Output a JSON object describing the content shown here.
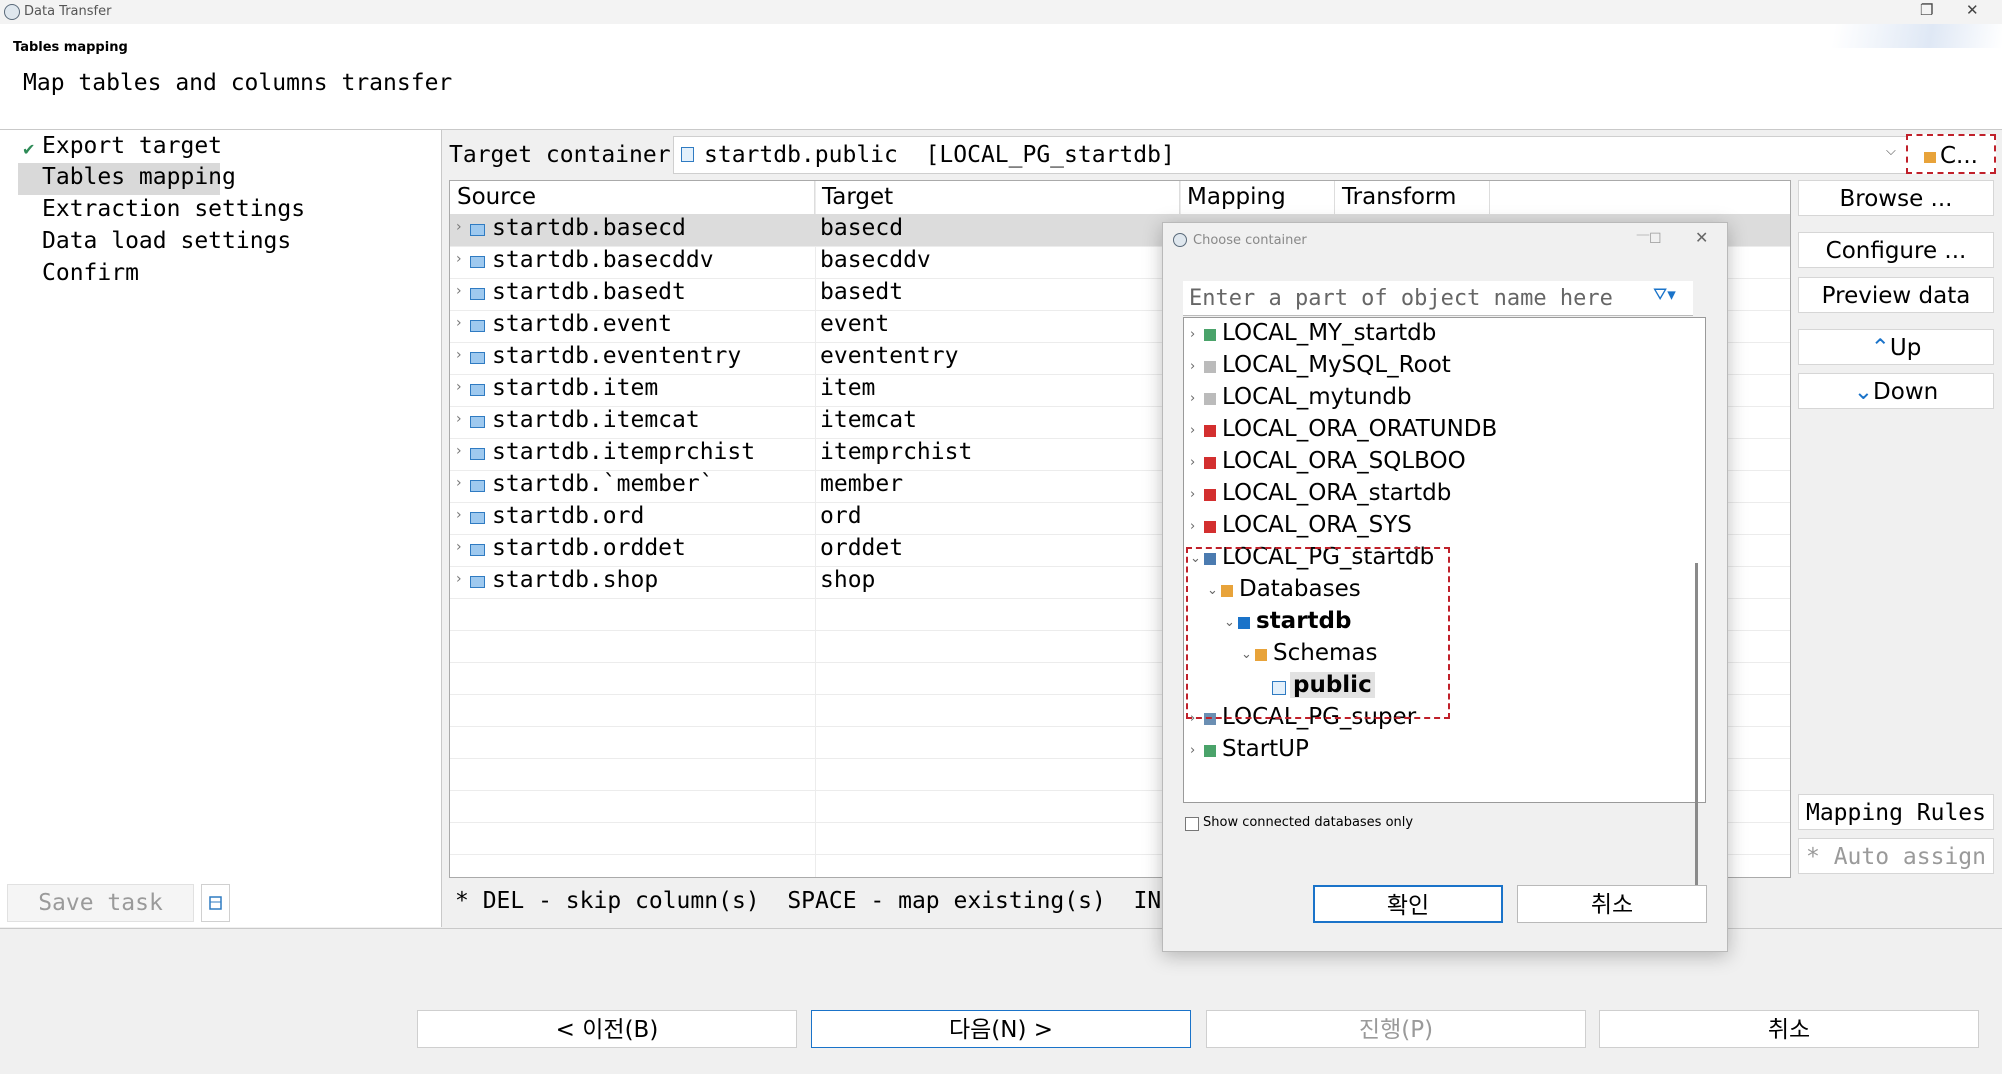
{
  "window": {
    "title": "Data Transfer"
  },
  "header": {
    "page_title": "Tables mapping",
    "description": "Map tables and columns transfer"
  },
  "nav": {
    "items": [
      "Export target",
      "Tables mapping",
      "Extraction settings",
      "Data load settings",
      "Confirm"
    ],
    "selected": "Tables mapping",
    "save_task": "Save task"
  },
  "target": {
    "label": "Target container:",
    "value": "startdb.public  [LOCAL_PG_startdb]",
    "choose_button": "C..."
  },
  "grid": {
    "columns": [
      "Source",
      "Target",
      "Mapping",
      "Transform"
    ],
    "rows": [
      {
        "source": "startdb.basecd",
        "target": "basecd"
      },
      {
        "source": "startdb.basecddv",
        "target": "basecddv"
      },
      {
        "source": "startdb.basedt",
        "target": "basedt"
      },
      {
        "source": "startdb.event",
        "target": "event"
      },
      {
        "source": "startdb.evententry",
        "target": "evententry"
      },
      {
        "source": "startdb.item",
        "target": "item"
      },
      {
        "source": "startdb.itemcat",
        "target": "itemcat"
      },
      {
        "source": "startdb.itemprchist",
        "target": "itemprchist"
      },
      {
        "source": "startdb.`member`",
        "target": "member"
      },
      {
        "source": "startdb.ord",
        "target": "ord"
      },
      {
        "source": "startdb.orddet",
        "target": "orddet"
      },
      {
        "source": "startdb.shop",
        "target": "shop"
      }
    ],
    "hint": "* DEL - skip column(s)  SPACE - map existing(s)  INSERT -"
  },
  "side_buttons": {
    "browse": "Browse ...",
    "configure": "Configure ...",
    "preview": "Preview data",
    "up": "Up",
    "down": "Down",
    "mapping_rules": "Mapping Rules",
    "auto_assign": "Auto assign"
  },
  "dialog": {
    "title": "Choose container",
    "search_placeholder": "Enter a part of object name here",
    "tree": [
      {
        "label": "LOCAL_MY_startdb",
        "icon": "mysql-connected-icon"
      },
      {
        "label": "LOCAL_MySQL_Root",
        "icon": "mysql-icon"
      },
      {
        "label": "LOCAL_mytundb",
        "icon": "mysql-icon"
      },
      {
        "label": "LOCAL_ORA_ORATUNDB",
        "icon": "oracle-icon"
      },
      {
        "label": "LOCAL_ORA_SQLBOO",
        "icon": "oracle-icon"
      },
      {
        "label": "LOCAL_ORA_startdb",
        "icon": "oracle-icon"
      },
      {
        "label": "LOCAL_ORA_SYS",
        "icon": "oracle-icon"
      },
      {
        "label": "LOCAL_PG_startdb",
        "icon": "postgres-connected-icon"
      },
      {
        "label": "Databases",
        "icon": "folder-icon"
      },
      {
        "label": "startdb",
        "icon": "database-icon"
      },
      {
        "label": "Schemas",
        "icon": "folder-icon"
      },
      {
        "label": "public",
        "icon": "schema-icon"
      },
      {
        "label": "LOCAL_PG_super",
        "icon": "postgres-icon"
      },
      {
        "label": "StartUP",
        "icon": "mysql-connected-icon"
      }
    ],
    "show_connected_label": "Show connected databases only",
    "ok": "확인",
    "cancel": "취소"
  },
  "footer": {
    "prev": "< 이전(B)",
    "next": "다음(N) >",
    "proceed": "진행(P)",
    "cancel": "취소"
  },
  "colors": {
    "accent": "#1a73c9",
    "highlight_dash": "#c0202a",
    "oracle_red": "#d32f2f",
    "folder_orange": "#e8a33a"
  }
}
